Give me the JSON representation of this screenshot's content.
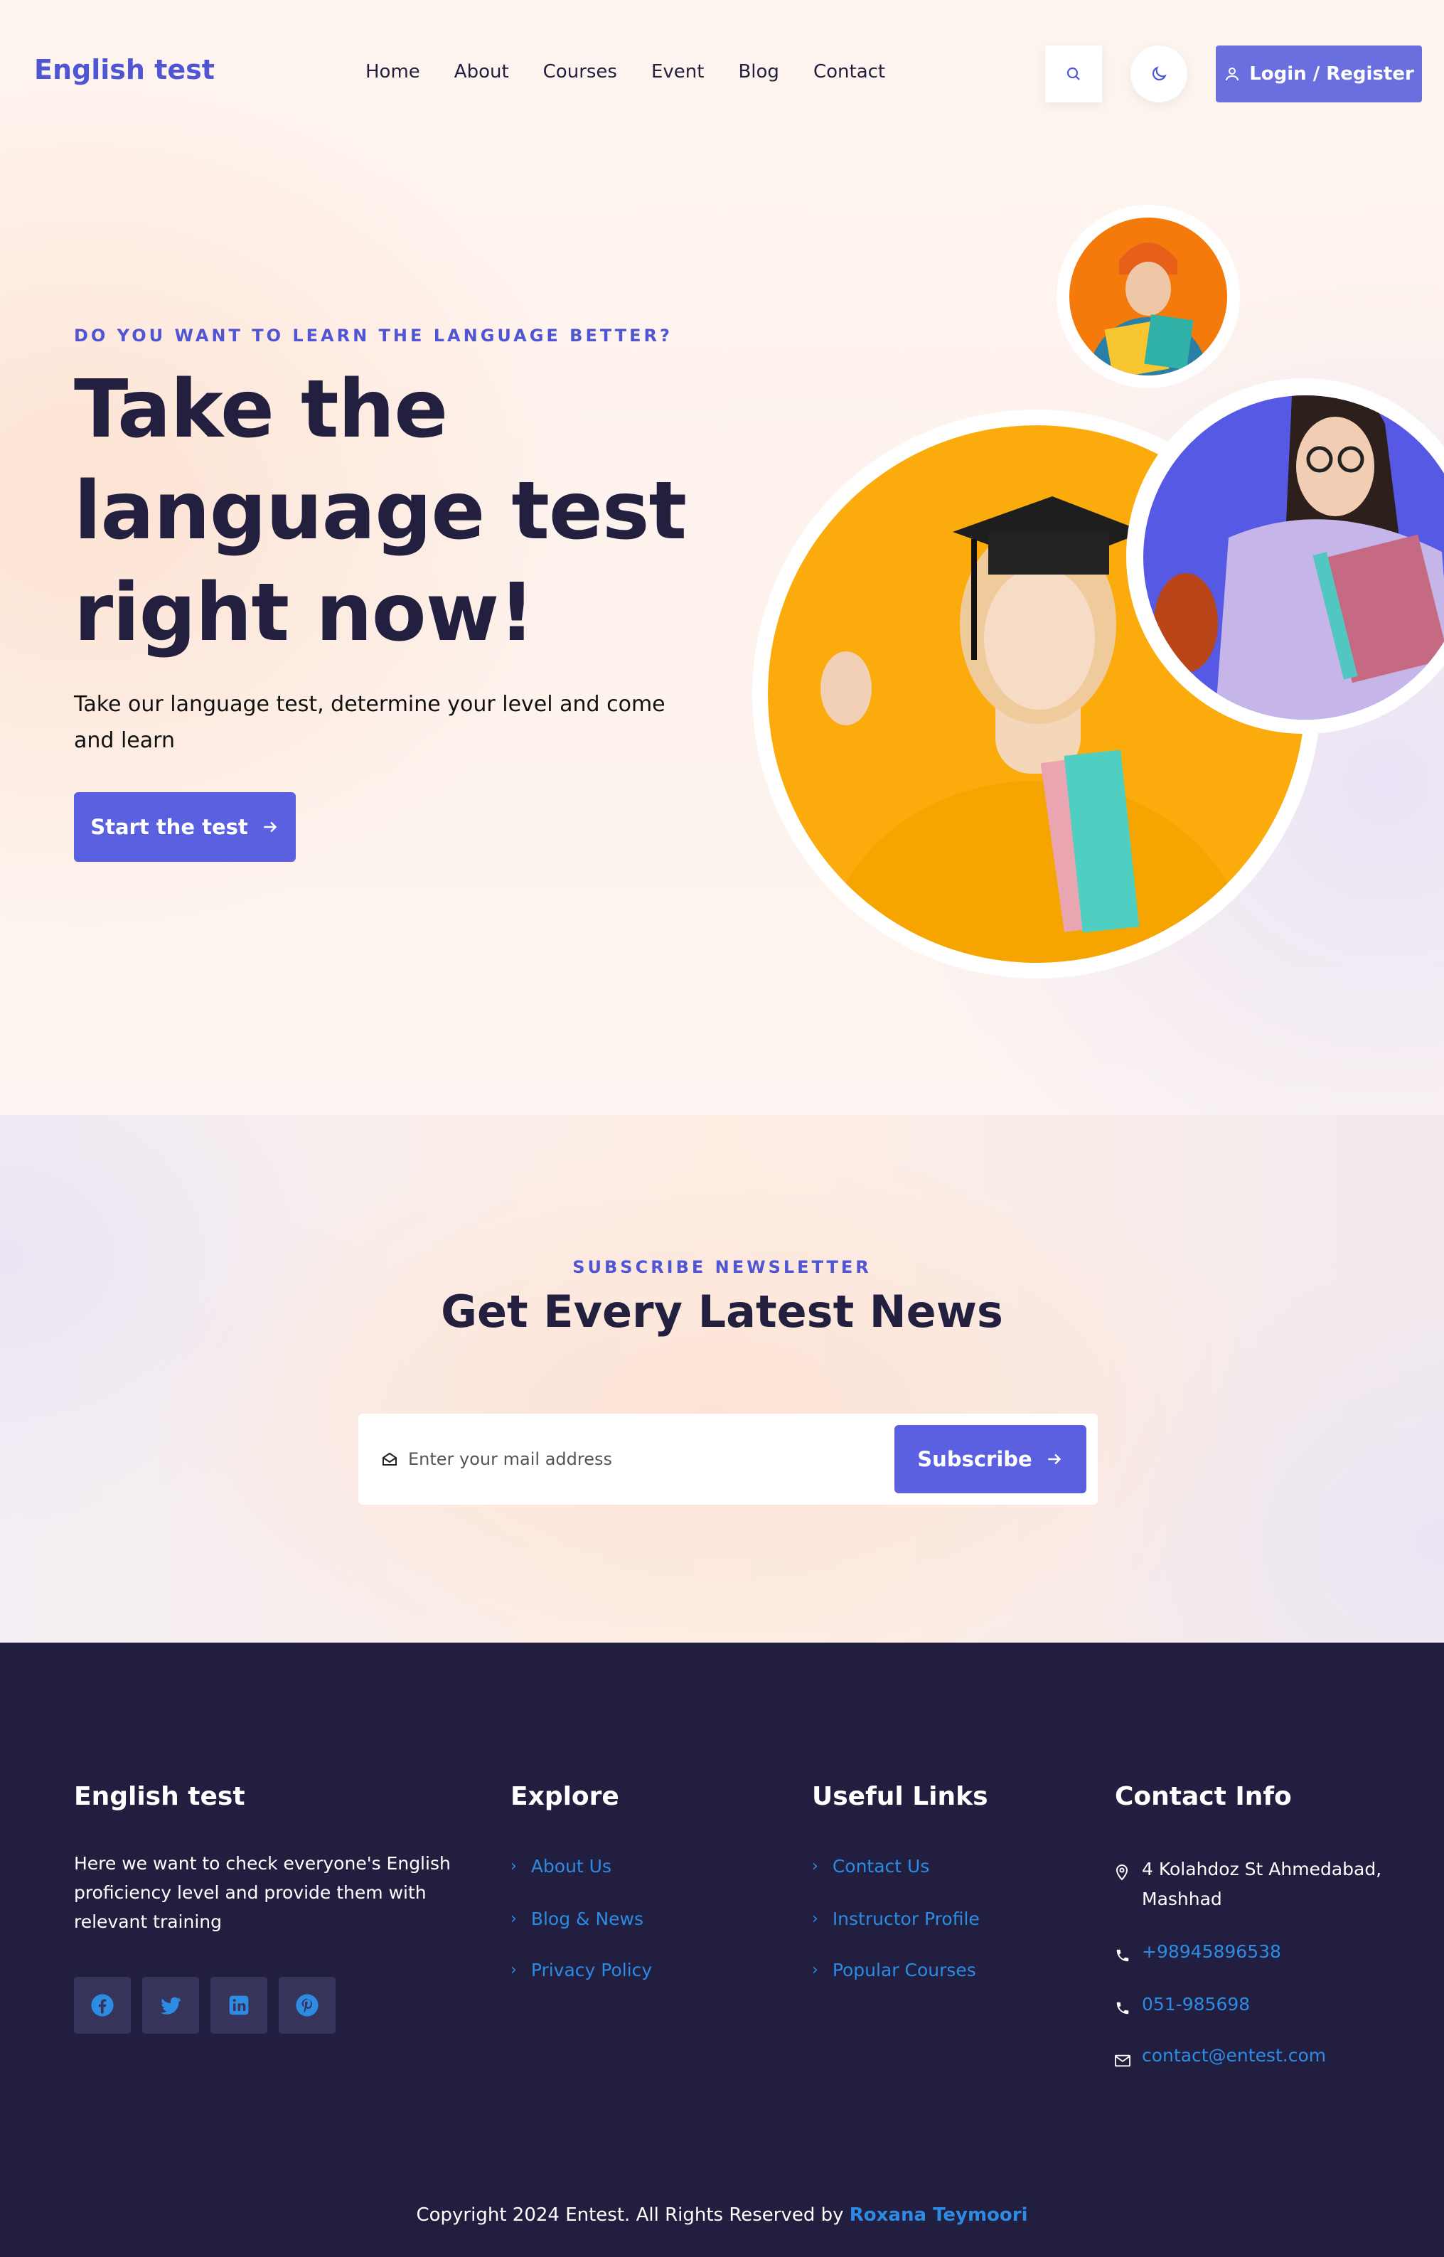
{
  "header": {
    "logo": "English test",
    "nav": [
      "Home",
      "About",
      "Courses",
      "Event",
      "Blog",
      "Contact"
    ],
    "search_icon": "search-icon",
    "theme_icon": "moon-icon",
    "login_label": "Login / Register",
    "accent": "#5a60df"
  },
  "hero": {
    "eyebrow": "DO YOU WANT TO LEARN THE LANGUAGE BETTER?",
    "title_lines": [
      "Take the",
      "language test",
      "right now!"
    ],
    "subtitle": "Take our language test, determine your level and come and learn",
    "cta_label": "Start the test"
  },
  "newsletter": {
    "eyebrow": "SUBSCRIBE NEWSLETTER",
    "title": "Get Every Latest News",
    "input_placeholder": "Enter your mail address",
    "button_label": "Subscribe"
  },
  "footer": {
    "brand_title": "English test",
    "brand_text": "Here we want to check everyone's English proficiency level and provide them with relevant training",
    "socials": [
      "facebook-icon",
      "twitter-icon",
      "linkedin-icon",
      "pinterest-icon"
    ],
    "explore": {
      "title": "Explore",
      "links": [
        "About Us",
        "Blog & News",
        "Privacy Policy"
      ]
    },
    "useful": {
      "title": "Useful Links",
      "links": [
        "Contact Us",
        "Instructor Profile",
        "Popular Courses"
      ]
    },
    "contact": {
      "title": "Contact Info",
      "address": "4 Kolahdoz St Ahmedabad, Mashhad",
      "phone1": "+98945896538",
      "phone2": "051-985698",
      "email": "contact@entest.com"
    },
    "copyright_prefix": "Copyright 2024 Entest. All Rights Reserved by",
    "copyright_author": "Roxana Teymoori"
  }
}
